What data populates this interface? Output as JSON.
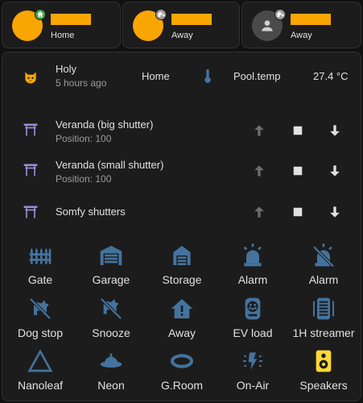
{
  "persons": [
    {
      "state": "Home",
      "avatar": "photo",
      "badge": "home-badge"
    },
    {
      "state": "Away",
      "avatar": "photo",
      "badge": "away-badge"
    },
    {
      "state": "Away",
      "avatar": "generic-person",
      "badge": "away-badge"
    }
  ],
  "status": {
    "name": "Holy",
    "time": "5 hours ago",
    "state": "Home",
    "sensor_label": "Pool.temp",
    "sensor_value": "27.4 °C"
  },
  "shutters": [
    {
      "name": "Veranda (big shutter)",
      "position": "Position: 100"
    },
    {
      "name": "Veranda (small shutter)",
      "position": "Position: 100"
    },
    {
      "name": "Somfy shutters",
      "position": ""
    }
  ],
  "buttons": [
    {
      "label": "Gate",
      "icon": "gate-icon"
    },
    {
      "label": "Garage",
      "icon": "garage-icon"
    },
    {
      "label": "Storage",
      "icon": "storage-icon"
    },
    {
      "label": "Alarm",
      "icon": "alarm-light-icon"
    },
    {
      "label": "Alarm",
      "icon": "alarm-off-icon"
    },
    {
      "label": "Dog stop",
      "icon": "dog-off-icon"
    },
    {
      "label": "Snooze",
      "icon": "snooze-icon"
    },
    {
      "label": "Away",
      "icon": "home-alert-icon"
    },
    {
      "label": "EV load",
      "icon": "ev-charger-icon"
    },
    {
      "label": "1H streamer",
      "icon": "streamer-icon"
    },
    {
      "label": "Nanoleaf",
      "icon": "nanoleaf-icon"
    },
    {
      "label": "Neon",
      "icon": "neon-icon"
    },
    {
      "label": "G.Room",
      "icon": "ring-light-icon"
    },
    {
      "label": "On-Air",
      "icon": "on-air-icon"
    },
    {
      "label": "Speakers",
      "icon": "speaker-icon"
    }
  ],
  "colors": {
    "background": "#111111",
    "card": "#1c1c1c",
    "accent_blue": "#44739e",
    "shutter_purple": "#9b8cd6",
    "speaker_yellow": "#fdd835",
    "badge_green": "#43a047",
    "badge_grey": "#9e9e9e",
    "avatar_orange": "#f9a602"
  }
}
